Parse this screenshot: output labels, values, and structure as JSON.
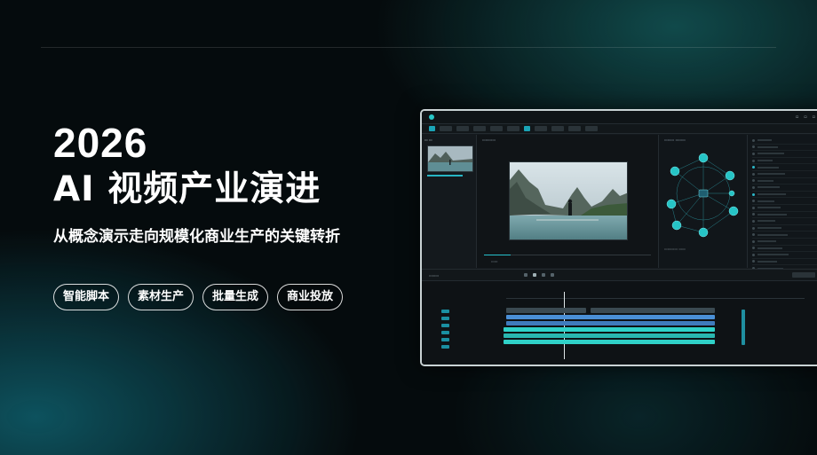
{
  "hero": {
    "year": "2026",
    "title": "AI 视频产业演进",
    "subtitle": "从概念演示走向规模化商业生产的关键转折",
    "tags": [
      "智能脚本",
      "素材生产",
      "批量生成",
      "商业投放"
    ]
  },
  "meta": {
    "top_left": "",
    "top_right": "",
    "bottom": ""
  },
  "editor": {
    "app_name": "",
    "menu": [
      "",
      "",
      "",
      "",
      "",
      ""
    ],
    "graph_nodes": [
      "",
      "",
      "",
      "",
      "",
      "",
      "",
      ""
    ],
    "prop_rows": 22,
    "colors": {
      "accent": "#29c6c7",
      "clip_blue": "#4a8fd6",
      "clip_teal": "#2fd1c8"
    }
  }
}
